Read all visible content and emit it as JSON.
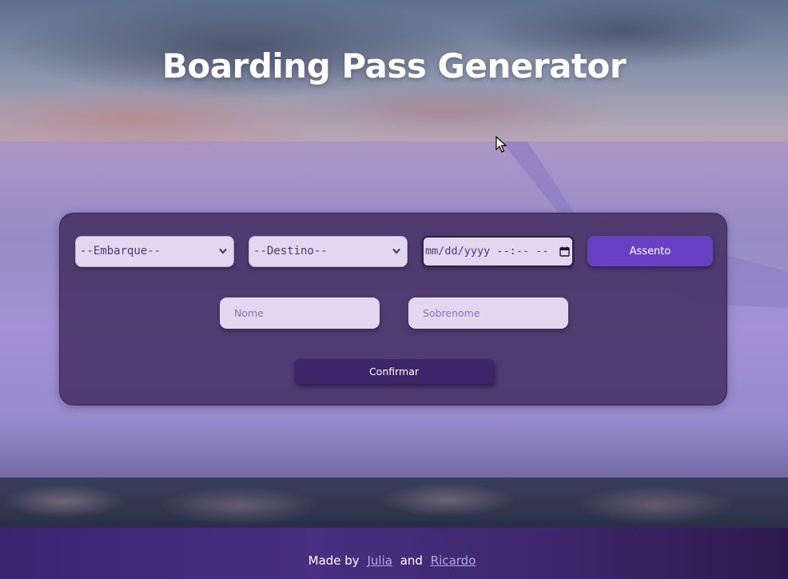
{
  "header": {
    "title": "Boarding Pass Generator"
  },
  "form": {
    "embarque": {
      "selected": "--Embarque--"
    },
    "destino": {
      "selected": "--Destino--"
    },
    "datetime": {
      "display": "mm/dd/yyyy --:-- --"
    },
    "seat_button_label": "Assento",
    "nome": {
      "placeholder": "Nome",
      "value": ""
    },
    "sobrenome": {
      "placeholder": "Sobrenome",
      "value": ""
    },
    "confirm_button_label": "Confirmar"
  },
  "footer": {
    "prefix": "Made by",
    "author1": "Julia",
    "connector": "and",
    "author2": "Ricardo"
  },
  "colors": {
    "accent": "#6740c4",
    "confirm": "#3e2468",
    "footer": "#3c2370",
    "input_background": "#e4d6ee",
    "card": "#46306a"
  },
  "icons": [
    "chevron-down-icon",
    "calendar-icon",
    "cursor-icon"
  ]
}
